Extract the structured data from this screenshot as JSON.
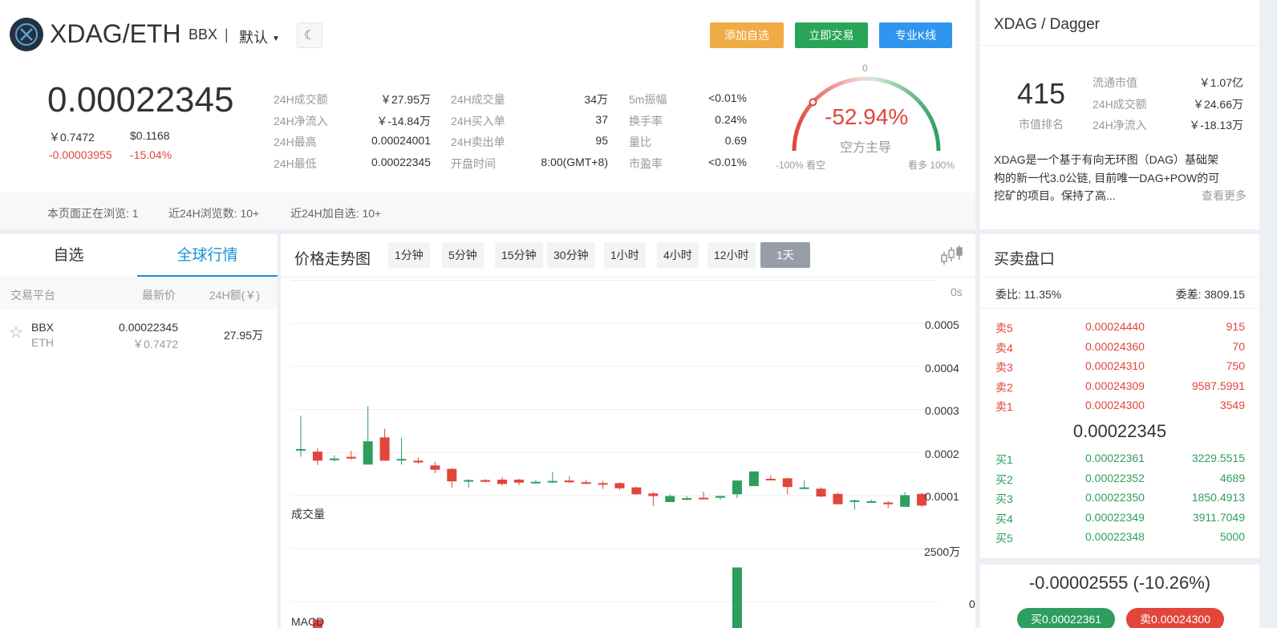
{
  "header": {
    "pair": "XDAG/ETH",
    "exchange": "BBX",
    "separator": "|",
    "mode": "默认",
    "buttons": {
      "add_watch": "添加自选",
      "trade_now": "立即交易",
      "pro_kline": "专业K线"
    }
  },
  "price": {
    "last": "0.00022345",
    "cny": "￥0.7472",
    "usd": "$0.1168",
    "change_abs": "-0.00003955",
    "change_pct": "-15.04%"
  },
  "stats": [
    {
      "label": "24H成交额",
      "value": "￥27.95万"
    },
    {
      "label": "24H净流入",
      "value": "￥-14.84万"
    },
    {
      "label": "24H最高",
      "value": "0.00024001"
    },
    {
      "label": "24H最低",
      "value": "0.00022345"
    },
    {
      "label": "24H成交量",
      "value": "34万"
    },
    {
      "label": "24H买入单",
      "value": "37"
    },
    {
      "label": "24H卖出单",
      "value": "95"
    },
    {
      "label": "开盘时间",
      "value": "8:00(GMT+8)"
    },
    {
      "label": "5m振幅",
      "value": "<0.01%"
    },
    {
      "label": "换手率",
      "value": "0.24%"
    },
    {
      "label": "量比",
      "value": "0.69"
    },
    {
      "label": "市盈率",
      "value": "<0.01%"
    }
  ],
  "gauge": {
    "value": "-52.94%",
    "value_num": -52.94,
    "label": "空方主导",
    "zero": "0",
    "left": "-100% 看空",
    "right": "看多 100%"
  },
  "viewers": {
    "now": "本页面正在浏览: 1",
    "views24": "近24H浏览数: 10+",
    "watch24": "近24H加自选: 10+"
  },
  "intro": {
    "title": "XDAG / Dagger",
    "rank": "415",
    "rank_label": "市值排名",
    "metrics": [
      {
        "label": "流通市值",
        "value": "￥1.07亿"
      },
      {
        "label": "24H成交额",
        "value": "￥24.66万"
      },
      {
        "label": "24H净流入",
        "value": "￥-18.13万"
      }
    ],
    "desc_line1": "XDAG是一个基于有向无环图（DAG）基础架",
    "desc_line2": "构的新一代3.0公链, 目前唯一DAG+POW的可",
    "desc_line3": "挖矿的项目。保持了高...",
    "more": "查看更多"
  },
  "market": {
    "tabs": [
      "自选",
      "全球行情"
    ],
    "headers": [
      "交易平台",
      "最新价",
      "24H额(￥)"
    ],
    "row": {
      "exchange": "BBX",
      "quote": "ETH",
      "price": "0.00022345",
      "cny": "￥0.7472",
      "amount": "27.95万"
    }
  },
  "chart": {
    "title": "价格走势图",
    "timeframes": [
      "1分钟",
      "5分钟",
      "15分钟",
      "30分钟",
      "1小时",
      "4小时",
      "12小时",
      "1天"
    ],
    "active_tf": "1天",
    "countdown": "0s",
    "y_ticks": [
      "0.0005",
      "0.0004",
      "0.0003",
      "0.0002",
      "0.0001"
    ],
    "volume_label": "成交量",
    "vol_ticks": [
      "2500万",
      "0"
    ],
    "macd_label": "MACD"
  },
  "chart_data": {
    "type": "candlestick",
    "ylim": [
      0.0001,
      0.0005
    ],
    "candles": [
      {
        "o": 0.00021,
        "h": 0.000287,
        "l": 0.000192,
        "c": 0.00021
      },
      {
        "o": 0.000204,
        "h": 0.000212,
        "l": 0.000173,
        "c": 0.000183
      },
      {
        "o": 0.000185,
        "h": 0.000196,
        "l": 0.000181,
        "c": 0.000188
      },
      {
        "o": 0.000192,
        "h": 0.000206,
        "l": 0.000185,
        "c": 0.000188
      },
      {
        "o": 0.000174,
        "h": 0.000309,
        "l": 0.000174,
        "c": 0.000228
      },
      {
        "o": 0.000237,
        "h": 0.000257,
        "l": 0.000183,
        "c": 0.000183
      },
      {
        "o": 0.000185,
        "h": 0.000236,
        "l": 0.000174,
        "c": 0.000187
      },
      {
        "o": 0.000183,
        "h": 0.00019,
        "l": 0.000176,
        "c": 0.000179
      },
      {
        "o": 0.000172,
        "h": 0.00018,
        "l": 0.000154,
        "c": 0.000162
      },
      {
        "o": 0.000164,
        "h": 0.000166,
        "l": 0.00012,
        "c": 0.000135
      },
      {
        "o": 0.000138,
        "h": 0.00014,
        "l": 0.00012,
        "c": 0.000138
      },
      {
        "o": 0.000138,
        "h": 0.00014,
        "l": 0.000133,
        "c": 0.000134
      },
      {
        "o": 0.000139,
        "h": 0.000145,
        "l": 0.000125,
        "c": 0.000129
      },
      {
        "o": 0.000139,
        "h": 0.000141,
        "l": 0.000126,
        "c": 0.000132
      },
      {
        "o": 0.000134,
        "h": 0.000138,
        "l": 0.00013,
        "c": 0.000134
      },
      {
        "o": 0.000136,
        "h": 0.000157,
        "l": 0.000132,
        "c": 0.000136
      },
      {
        "o": 0.000137,
        "h": 0.000147,
        "l": 0.000131,
        "c": 0.000133
      },
      {
        "o": 0.000133,
        "h": 0.000138,
        "l": 0.000129,
        "c": 0.00013
      },
      {
        "o": 0.000131,
        "h": 0.000136,
        "l": 0.000118,
        "c": 0.00013
      },
      {
        "o": 0.000131,
        "h": 0.000133,
        "l": 0.000115,
        "c": 0.000119
      },
      {
        "o": 0.000121,
        "h": 0.000123,
        "l": 0.000104,
        "c": 0.000105
      },
      {
        "o": 0.000107,
        "h": 0.000111,
        "l": 7.8e-05,
        "c": 0.000101
      },
      {
        "o": 8.7e-05,
        "h": 0.000105,
        "l": 8.7e-05,
        "c": 0.000101
      },
      {
        "o": 9.6e-05,
        "h": 0.000101,
        "l": 9.1e-05,
        "c": 9.6e-05
      },
      {
        "o": 9.7e-05,
        "h": 0.000111,
        "l": 9.5e-05,
        "c": 9.6e-05
      },
      {
        "o": 9.7e-05,
        "h": 0.000101,
        "l": 9.3e-05,
        "c": 0.000101
      },
      {
        "o": 0.000105,
        "h": 0.000137,
        "l": 9.6e-05,
        "c": 0.000137
      },
      {
        "o": 0.000124,
        "h": 0.000158,
        "l": 0.000124,
        "c": 0.000158
      },
      {
        "o": 0.000141,
        "h": 0.000149,
        "l": 0.000139,
        "c": 0.00014
      },
      {
        "o": 0.000142,
        "h": 0.000144,
        "l": 0.000105,
        "c": 0.000122
      },
      {
        "o": 0.000121,
        "h": 0.000137,
        "l": 0.000118,
        "c": 0.000121
      },
      {
        "o": 0.000118,
        "h": 0.000121,
        "l": 9.8e-05,
        "c": 0.0001
      },
      {
        "o": 0.000106,
        "h": 0.000109,
        "l": 8.6e-05,
        "c": 8.2e-05
      },
      {
        "o": 8.9e-05,
        "h": 9.3e-05,
        "l": 6.9e-05,
        "c": 9.1e-05
      },
      {
        "o": 8.8e-05,
        "h": 9.3e-05,
        "l": 8.7e-05,
        "c": 8.9e-05
      },
      {
        "o": 8.6e-05,
        "h": 8.9e-05,
        "l": 7.3e-05,
        "c": 8.2e-05
      },
      {
        "o": 7.6e-05,
        "h": 0.00011,
        "l": 7.6e-05,
        "c": 0.000103
      },
      {
        "o": 0.000106,
        "h": 0.000108,
        "l": 7.6e-05,
        "c": 7.9e-05
      }
    ],
    "volume": [
      0.4,
      1.3,
      0.5,
      0.4,
      0.4,
      0.4,
      0.4,
      0.4,
      0.4,
      0.4,
      0.4,
      0.4,
      0.4,
      0.4,
      0.4,
      0.4,
      0.4,
      0.4,
      0.4,
      0.4,
      0.4,
      0.4,
      0.4,
      0.4,
      0.4,
      0.4,
      3.9,
      0.4,
      0.4,
      0.4,
      0.4,
      0.4,
      0.4,
      0.4,
      0.4,
      0.4,
      0.4,
      0.4
    ],
    "volume_unit": "千万"
  },
  "orderbook": {
    "title": "买卖盘口",
    "ratio": "委比: 11.35%",
    "diff": "委差: 3809.15",
    "asks": [
      {
        "label": "卖5",
        "price": "0.00024440",
        "qty": "915"
      },
      {
        "label": "卖4",
        "price": "0.00024360",
        "qty": "70"
      },
      {
        "label": "卖3",
        "price": "0.00024310",
        "qty": "750"
      },
      {
        "label": "卖2",
        "price": "0.00024309",
        "qty": "9587.5991"
      },
      {
        "label": "卖1",
        "price": "0.00024300",
        "qty": "3549"
      }
    ],
    "mid": "0.00022345",
    "bids": [
      {
        "label": "买1",
        "price": "0.00022361",
        "qty": "3229.5515"
      },
      {
        "label": "买2",
        "price": "0.00022352",
        "qty": "4689"
      },
      {
        "label": "买3",
        "price": "0.00022350",
        "qty": "1850.4913"
      },
      {
        "label": "买4",
        "price": "0.00022349",
        "qty": "3911.7049"
      },
      {
        "label": "买5",
        "price": "0.00022348",
        "qty": "5000"
      }
    ],
    "change": "-0.00002555 (-10.26%)",
    "bid_btn": "买0.00022361",
    "ask_btn": "卖0.00024300"
  },
  "colors": {
    "up": "#2e9e5e",
    "down": "#e2453a",
    "accent": "#1a90d8",
    "orange": "#f0ab45",
    "blue": "#2f95ee"
  }
}
